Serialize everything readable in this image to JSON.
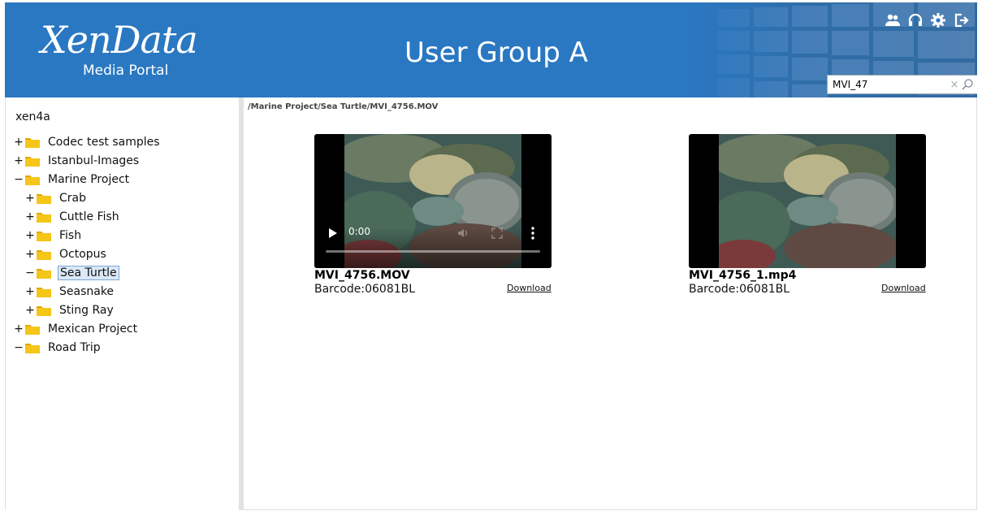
{
  "header": {
    "logo_main": "XenData",
    "logo_sub": "Media Portal",
    "title": "User Group A",
    "icons": [
      "users-icon",
      "headset-icon",
      "gear-icon",
      "logout-icon"
    ],
    "search": {
      "value": "MVI_47",
      "clear_symbol": "×"
    },
    "bg_color": "#2a78c2"
  },
  "sidebar": {
    "root": "xen4a",
    "toggles": {
      "expanded": "−",
      "collapsed": "+"
    },
    "tree": [
      {
        "label": "Codec test samples",
        "toggle": "+",
        "level": 0
      },
      {
        "label": "Istanbul-Images",
        "toggle": "+",
        "level": 0
      },
      {
        "label": "Marine Project",
        "toggle": "−",
        "level": 0
      },
      {
        "label": "Crab",
        "toggle": "+",
        "level": 1
      },
      {
        "label": "Cuttle Fish",
        "toggle": "+",
        "level": 1
      },
      {
        "label": "Fish",
        "toggle": "+",
        "level": 1
      },
      {
        "label": "Octopus",
        "toggle": "+",
        "level": 1
      },
      {
        "label": "Sea Turtle",
        "toggle": "−",
        "level": 1,
        "selected": true
      },
      {
        "label": "Seasnake",
        "toggle": "+",
        "level": 1
      },
      {
        "label": "Sting Ray",
        "toggle": "+",
        "level": 1
      },
      {
        "label": "Mexican Project",
        "toggle": "+",
        "level": 0
      },
      {
        "label": "Road Trip",
        "toggle": "−",
        "level": 0
      }
    ]
  },
  "main": {
    "breadcrumb": "/Marine Project/Sea Turtle/MVI_4756.MOV",
    "files": [
      {
        "name": "MVI_4756.MOV",
        "barcode": "Barcode:06081BL",
        "download": "Download",
        "time": "0:00",
        "controls_visible": true
      },
      {
        "name": "MVI_4756_1.mp4",
        "barcode": "Barcode:06081BL",
        "download": "Download",
        "time": "",
        "controls_visible": false
      }
    ]
  },
  "colors": {
    "folder": "#f5c518",
    "selection": "#dbe8f7"
  }
}
